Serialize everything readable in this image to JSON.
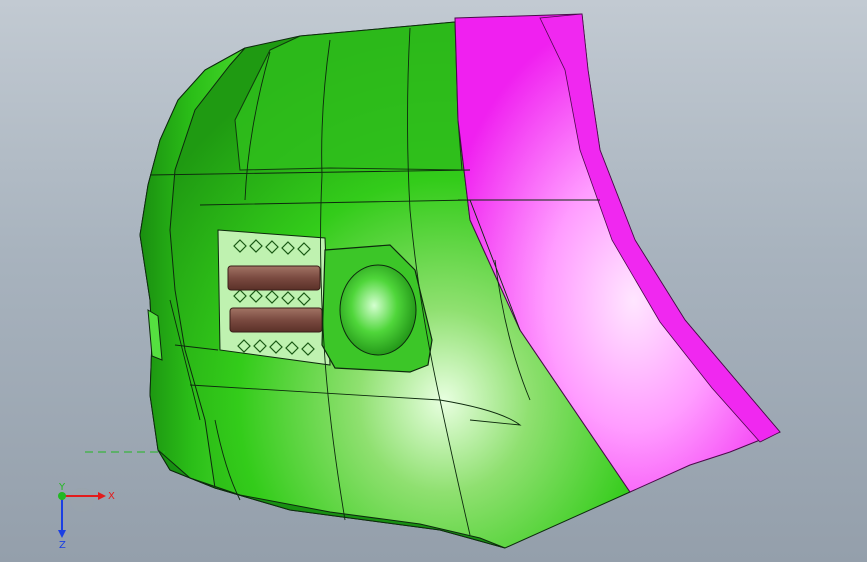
{
  "viewport": {
    "background_top": "#c2cad2",
    "background_bottom": "#949fab"
  },
  "model": {
    "body_color": "#33cc1a",
    "body_highlight": "#ccffcc",
    "body_shadow": "#178c10",
    "fender_color": "#ff19ff",
    "fender_highlight": "#ffd9ff",
    "bar_color": "#7a4a40",
    "edge_color": "#0d2a0d"
  },
  "triad": {
    "x_label": "X",
    "y_label": "Y",
    "z_label": "Z",
    "x_color": "#e31b1b",
    "y_color": "#22b822",
    "z_color": "#1b3fe3"
  }
}
